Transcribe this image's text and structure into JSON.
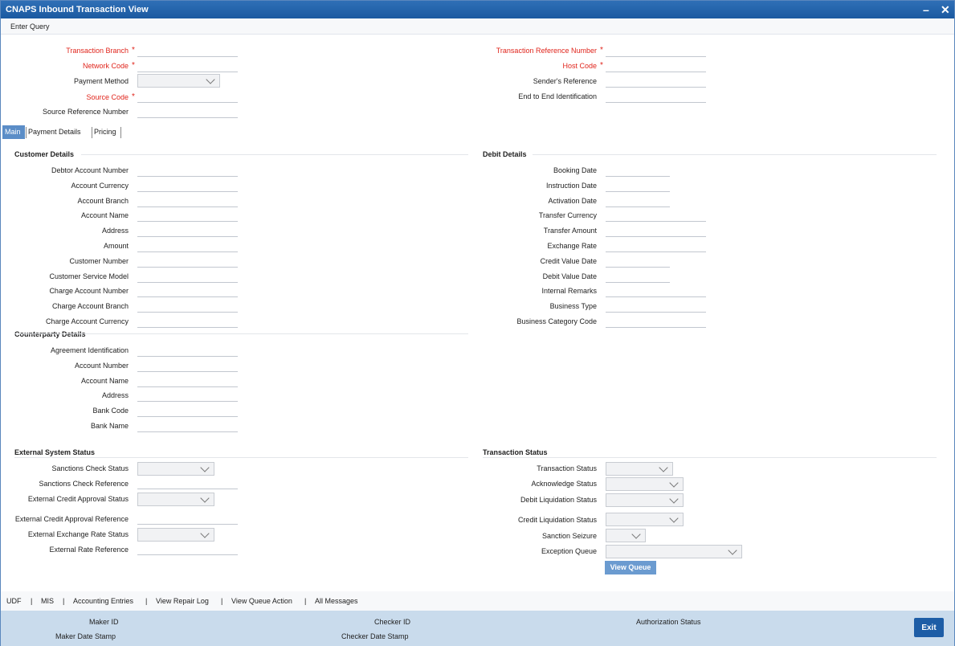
{
  "window": {
    "title": "CNAPS Inbound Transaction View",
    "minimize": "–",
    "close": "✕"
  },
  "menu": {
    "enter_query": "Enter Query"
  },
  "header_fields": {
    "transaction_branch": "Transaction Branch",
    "network_code": "Network Code",
    "payment_method": "Payment Method",
    "source_code": "Source Code",
    "source_reference_number": "Source Reference Number",
    "transaction_reference_number": "Transaction Reference Number",
    "host_code": "Host Code",
    "senders_reference": "Sender's Reference",
    "end_to_end_identification": "End to End Identification",
    "required_marker": "*"
  },
  "tabs": [
    "Main",
    "Payment Details",
    "Pricing"
  ],
  "customer_details": {
    "title": "Customer Details",
    "fields": [
      "Debtor Account Number",
      "Account Currency",
      "Account Branch",
      "Account Name",
      "Address",
      "Amount",
      "Customer Number",
      "Customer Service Model",
      "Charge Account Number",
      "Charge Account Branch",
      "Charge Account Currency"
    ]
  },
  "debit_details": {
    "title": "Debit Details",
    "fields": [
      "Booking Date",
      "Instruction Date",
      "Activation Date",
      "Transfer Currency",
      "Transfer Amount",
      "Exchange Rate",
      "Credit Value Date",
      "Debit Value Date",
      "Internal Remarks",
      "Business Type",
      "Business Category Code"
    ]
  },
  "counterparty_details": {
    "title": "Counterparty Details",
    "fields": [
      "Agreement Identification",
      "Account Number",
      "Account Name",
      "Address",
      "Bank Code",
      "Bank Name"
    ]
  },
  "external_system_status": {
    "title": "External System Status",
    "fields": [
      "Sanctions Check Status",
      "Sanctions Check Reference",
      "External Credit Approval Status",
      "External Credit Approval Reference",
      "External Exchange Rate Status",
      "External Rate Reference"
    ]
  },
  "transaction_status": {
    "title": "Transaction Status",
    "fields": [
      "Transaction Status",
      "Acknowledge Status",
      "Debit Liquidation Status",
      "Credit Liquidation Status",
      "Sanction Seizure",
      "Exception Queue"
    ],
    "view_queue": "View Queue"
  },
  "links": [
    "UDF",
    "|",
    "MIS",
    "|",
    "Accounting Entries",
    "|",
    "View Repair Log",
    "|",
    "View Queue Action",
    "|",
    "All Messages"
  ],
  "footer": {
    "maker_id": "Maker ID",
    "maker_date_stamp": "Maker Date Stamp",
    "checker_id": "Checker ID",
    "checker_date_stamp": "Checker Date Stamp",
    "authorization_status": "Authorization Status",
    "exit": "Exit"
  }
}
